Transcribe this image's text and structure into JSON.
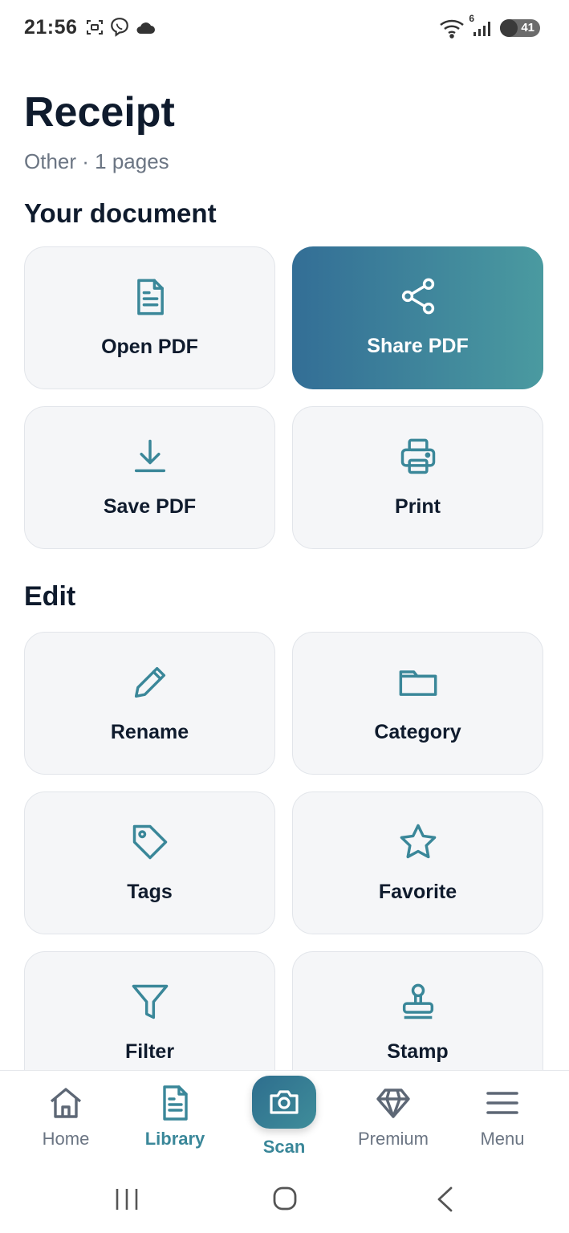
{
  "status_bar": {
    "time": "21:56",
    "battery": "41",
    "network_badge": "6"
  },
  "header": {
    "title": "Receipt",
    "subtitle": "Other · 1 pages"
  },
  "sections": {
    "document": "Your document",
    "edit": "Edit"
  },
  "document_actions": [
    {
      "label": "Open PDF",
      "icon": "file-icon"
    },
    {
      "label": "Share PDF",
      "icon": "share-icon"
    },
    {
      "label": "Save PDF",
      "icon": "download-icon"
    },
    {
      "label": "Print",
      "icon": "printer-icon"
    }
  ],
  "edit_actions": [
    {
      "label": "Rename",
      "icon": "pencil-icon"
    },
    {
      "label": "Category",
      "icon": "folder-icon"
    },
    {
      "label": "Tags",
      "icon": "tag-icon"
    },
    {
      "label": "Favorite",
      "icon": "star-icon"
    },
    {
      "label": "Filter",
      "icon": "filter-icon"
    },
    {
      "label": "Stamp",
      "icon": "stamp-icon"
    }
  ],
  "bottom_nav": {
    "home": "Home",
    "library": "Library",
    "scan": "Scan",
    "premium": "Premium",
    "menu": "Menu",
    "active": "Library"
  },
  "colors": {
    "accent": "#3a8799",
    "primary_gradient_start": "#336e96",
    "primary_gradient_end": "#4a9aa0",
    "tile_bg": "#f5f6f8",
    "text_dark": "#0f1b2d",
    "text_muted": "#6b7583"
  }
}
